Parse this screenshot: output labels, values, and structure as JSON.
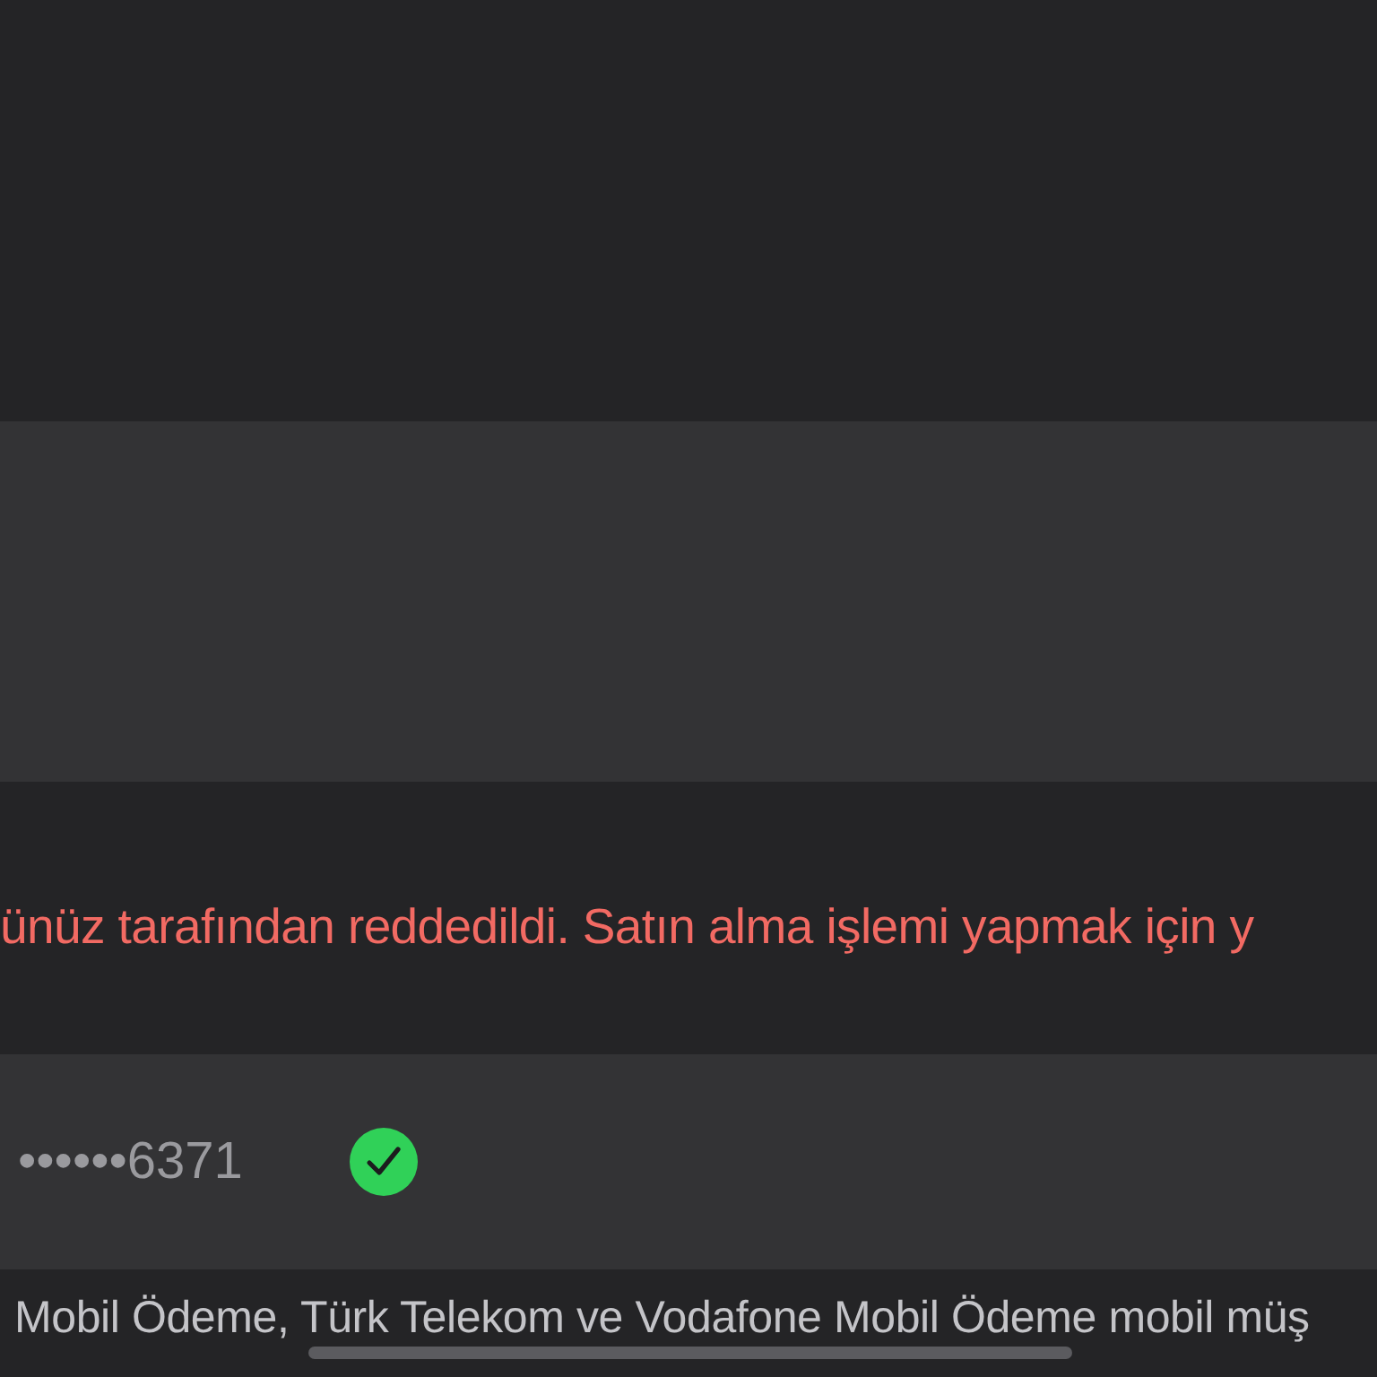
{
  "error_message": "ünüz tarafından reddedildi. Satın alma işlemi yapmak için y",
  "payment_method": {
    "masked_number": "••••••6371",
    "verified": true
  },
  "info_lines": [
    "Mobil Ödeme, Türk Telekom ve Vodafone Mobil Ödeme mobil müş"
  ]
}
